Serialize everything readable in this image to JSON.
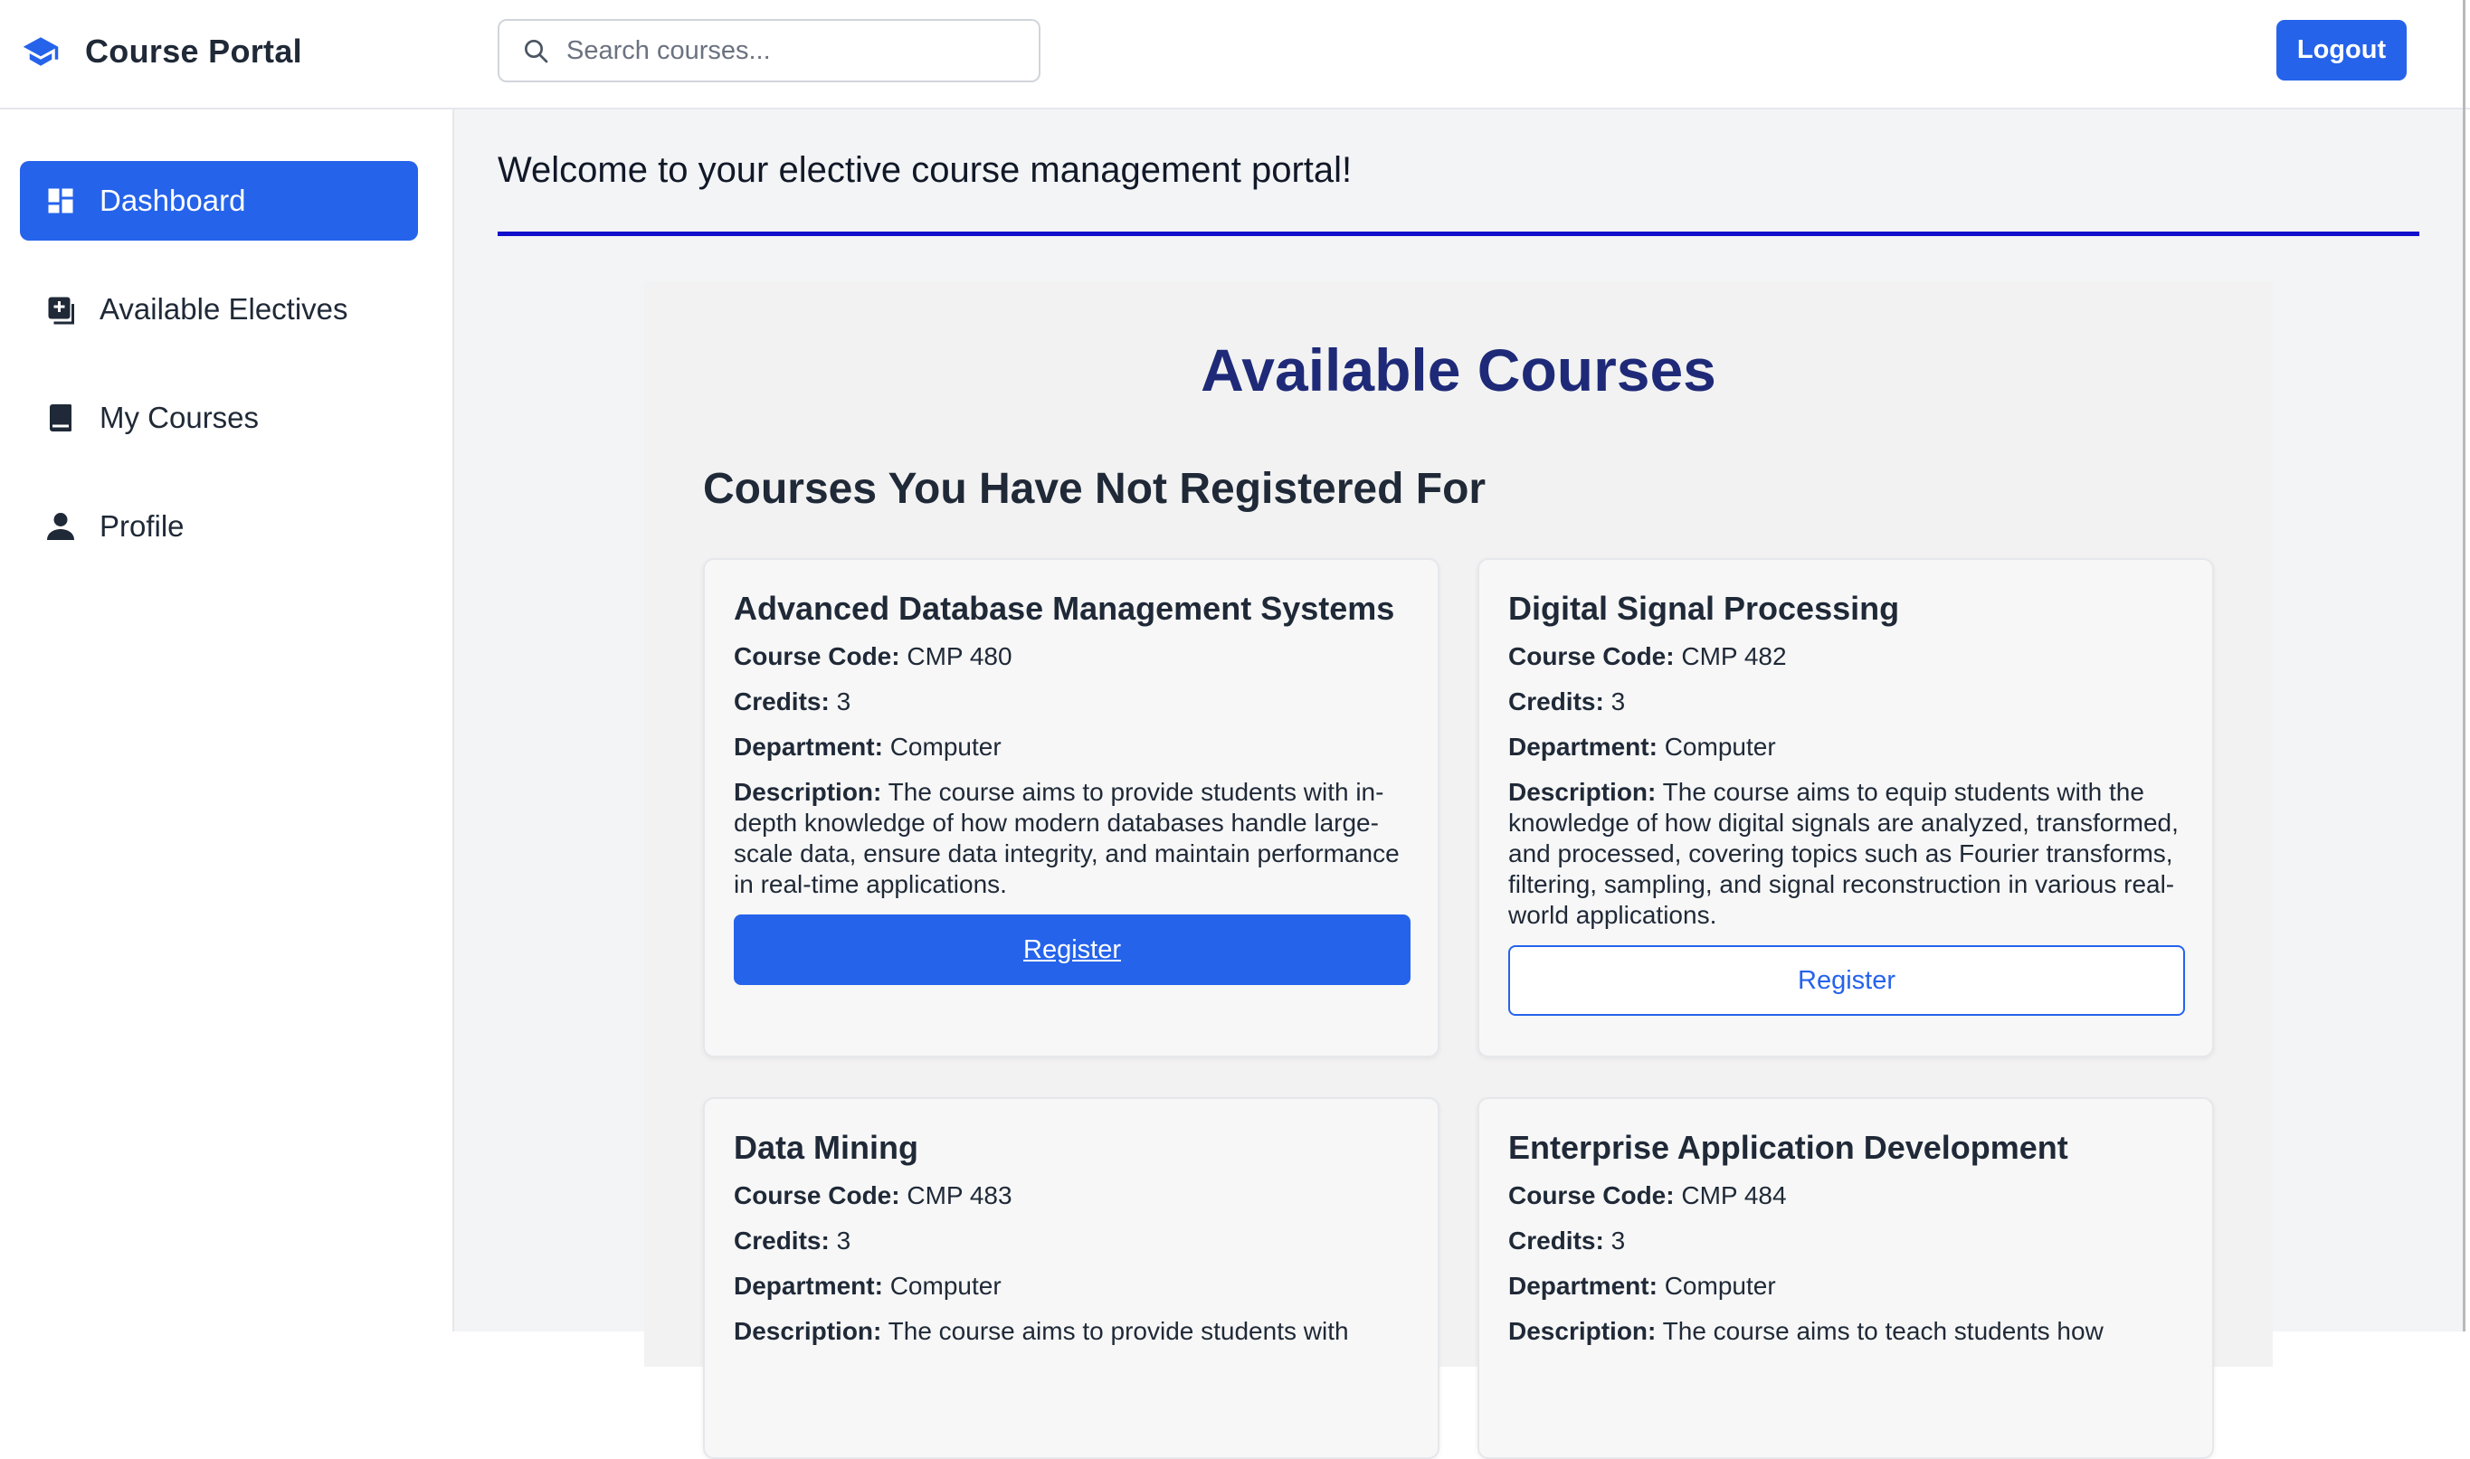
{
  "header": {
    "brand": "Course Portal",
    "search_placeholder": "Search courses...",
    "logout_label": "Logout"
  },
  "sidebar": {
    "items": [
      {
        "label": "Dashboard",
        "icon": "dashboard-icon",
        "active": true
      },
      {
        "label": "Available Electives",
        "icon": "add-box-icon",
        "active": false
      },
      {
        "label": "My Courses",
        "icon": "book-icon",
        "active": false
      },
      {
        "label": "Profile",
        "icon": "person-icon",
        "active": false
      }
    ]
  },
  "main": {
    "welcome": "Welcome to your elective course management portal!",
    "panel_title": "Available Courses",
    "section_title": "Courses You Have Not Registered For",
    "labels": {
      "code": "Course Code:",
      "credits": "Credits:",
      "department": "Department:",
      "description": "Description:"
    },
    "courses": [
      {
        "title": "Advanced Database Management Systems",
        "code": "CMP 480",
        "credits": "3",
        "department": "Computer",
        "description": "The course aims to provide students with in-depth knowledge of how modern databases handle large-scale data, ensure data integrity, and maintain performance in real-time applications.",
        "button": "Register"
      },
      {
        "title": "Digital Signal Processing",
        "code": "CMP 482",
        "credits": "3",
        "department": "Computer",
        "description": "The course aims to equip students with the knowledge of how digital signals are analyzed, transformed, and processed, covering topics such as Fourier transforms, filtering, sampling, and signal reconstruction in various real-world applications.",
        "button": "Register"
      },
      {
        "title": "Data Mining",
        "code": "CMP 483",
        "credits": "3",
        "department": "Computer",
        "description": "The course aims to provide students with"
      },
      {
        "title": "Enterprise Application Development",
        "code": "CMP 484",
        "credits": "3",
        "department": "Computer",
        "description": "The course aims to teach students how"
      }
    ]
  },
  "colors": {
    "accent": "#2563eb",
    "heading_navy": "#1e2a78",
    "rule_blue": "#1010cc"
  }
}
